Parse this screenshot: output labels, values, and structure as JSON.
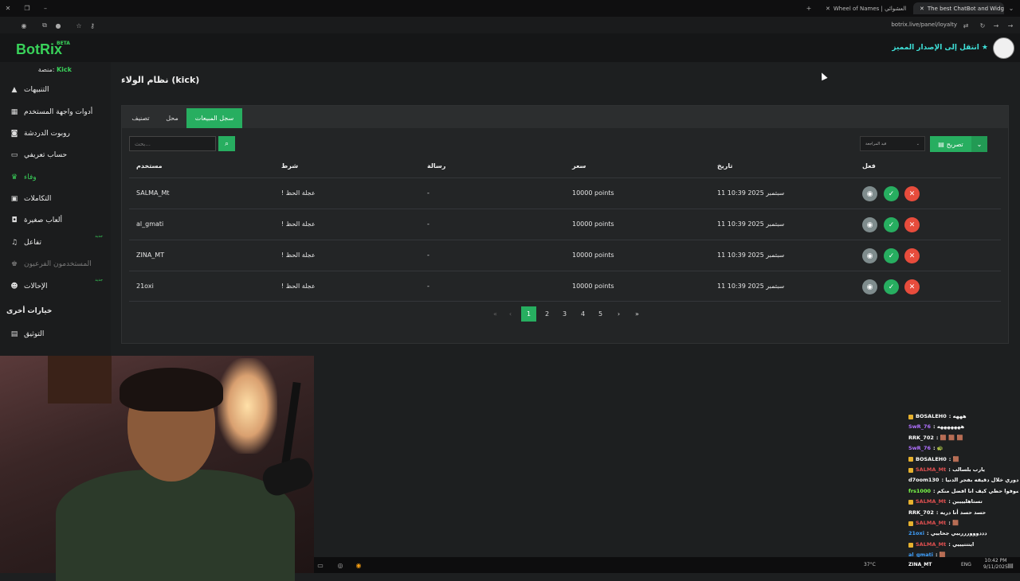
{
  "browser": {
    "tabs": [
      {
        "label": "Wheel of Names | العشوائي"
      },
      {
        "label": "The best ChatBot and Widget:"
      }
    ],
    "url": "botrix.live/panel/loyalty"
  },
  "header": {
    "logo": "BotRix",
    "beta": "BETA",
    "premium": "انتقل إلى الإصدار المميز"
  },
  "sidebar": {
    "platform_label": "منصة:",
    "platform_value": "Kick",
    "items": [
      {
        "label": "التنبيهات",
        "icon": "warning-icon",
        "glyph": "▲"
      },
      {
        "label": "أدوات واجهة المستخدم",
        "icon": "grid-icon",
        "glyph": "▦"
      },
      {
        "label": "روبوت الدردشة",
        "icon": "robot-icon",
        "glyph": "◙"
      },
      {
        "label": "حساب تعريفي",
        "icon": "id-card-icon",
        "glyph": "▭"
      },
      {
        "label": "وفاء",
        "icon": "trophy-icon",
        "glyph": "♛"
      },
      {
        "label": "التكاملات",
        "icon": "integrations-icon",
        "glyph": "▣"
      },
      {
        "label": "ألعاب صغيرة",
        "icon": "gamepad-icon",
        "glyph": "◘"
      },
      {
        "label": "تفاعل",
        "icon": "music-icon",
        "glyph": "♫",
        "badge": "جديد"
      },
      {
        "label": "المستخدمون الفرعيون",
        "icon": "crown-icon",
        "glyph": "♚"
      },
      {
        "label": "الإحالات",
        "icon": "users-icon",
        "glyph": "☻",
        "badge": "جديد"
      }
    ],
    "section_other": "خيارات أخرى",
    "docs": {
      "label": "التوثيق",
      "icon": "document-icon",
      "glyph": "▤"
    }
  },
  "page": {
    "title": "نظام الولاء (kick)",
    "tabs": [
      "تصنيف",
      "محل",
      "سجل المبيعات"
    ],
    "search_placeholder": "بحث...",
    "filter_value": "قيد المراجعة",
    "export_label": "تصريح",
    "columns": [
      "مستخدم",
      "شرط",
      "رسالة",
      "سعر",
      "تاريخ",
      "فعل"
    ],
    "rows": [
      {
        "user": "SALMA_Mt",
        "item": "! عجلة الحظ",
        "message": "-",
        "price": "10000 points",
        "date": "11 سبتمبر 2025 10:39"
      },
      {
        "user": "al_gmati",
        "item": "! عجلة الحظ",
        "message": "-",
        "price": "10000 points",
        "date": "11 سبتمبر 2025 10:39"
      },
      {
        "user": "ZINA_MT",
        "item": "! عجلة الحظ",
        "message": "-",
        "price": "10000 points",
        "date": "11 سبتمبر 2025 10:39"
      },
      {
        "user": "21oxi",
        "item": "! عجلة الحظ",
        "message": "-",
        "price": "10000 points",
        "date": "11 سبتمبر 2025 10:39"
      }
    ],
    "pagination": [
      "1",
      "2",
      "3",
      "4",
      "5"
    ]
  },
  "chat": [
    {
      "user": "BOSALEH0",
      "text": ": هههه",
      "color": "#ffffff",
      "badges": true
    },
    {
      "user": "SwR_76",
      "text": ": هههههههه",
      "color": "#b070ff",
      "badges": false
    },
    {
      "user": "RRK_702",
      "text": ": 🟫 🟫 🟫",
      "color": "#ffffff",
      "badges": false
    },
    {
      "user": "SwR_76",
      "text": ": 🐢",
      "color": "#b070ff",
      "badges": false
    },
    {
      "user": "BOSALEH0",
      "text": ": 🟫",
      "color": "#ffffff",
      "badges": true
    },
    {
      "user": "SALMA_Mt",
      "text": ": يارب بلسالب",
      "color": "#e05050",
      "badges": true
    },
    {
      "user": "d7oom130",
      "text": ": ان ما جاء دوري خلال دقيقه بفجر الدنيا",
      "color": "#ffffff",
      "badges": false
    },
    {
      "user": "frs1000",
      "text": ": فين انا شوفوا حظي كيف انا افضل منكم",
      "color": "#7cff4a",
      "badges": false
    },
    {
      "user": "SALMA_Mt",
      "text": ": تستاهليييين",
      "color": "#e05050",
      "badges": true
    },
    {
      "user": "RRK_702",
      "text": ": حسد حسد أنا دريه",
      "color": "#ffffff",
      "badges": false
    },
    {
      "user": "SALMA_Mt",
      "text": ": 🟫",
      "color": "#e05050",
      "badges": true
    },
    {
      "user": "21oxi",
      "text": ": دددووورررييي جحاييي",
      "color": "#3ea0ff",
      "badges": false
    },
    {
      "user": "SALMA_Mt",
      "text": ": ايتتتيييي",
      "color": "#e05050",
      "badges": true
    },
    {
      "user": "al_gmati",
      "text": ": 🟫",
      "color": "#3ea0ff",
      "badges": false
    }
  ],
  "taskbar": {
    "weather": "37°C",
    "stream_label": "ZINA_MT",
    "lang": "ENG",
    "time": "10:42 PM",
    "date": "9/11/2025"
  },
  "colors": {
    "accent": "#27ae60",
    "danger": "#e74c3c",
    "brand": "#39d25a"
  }
}
